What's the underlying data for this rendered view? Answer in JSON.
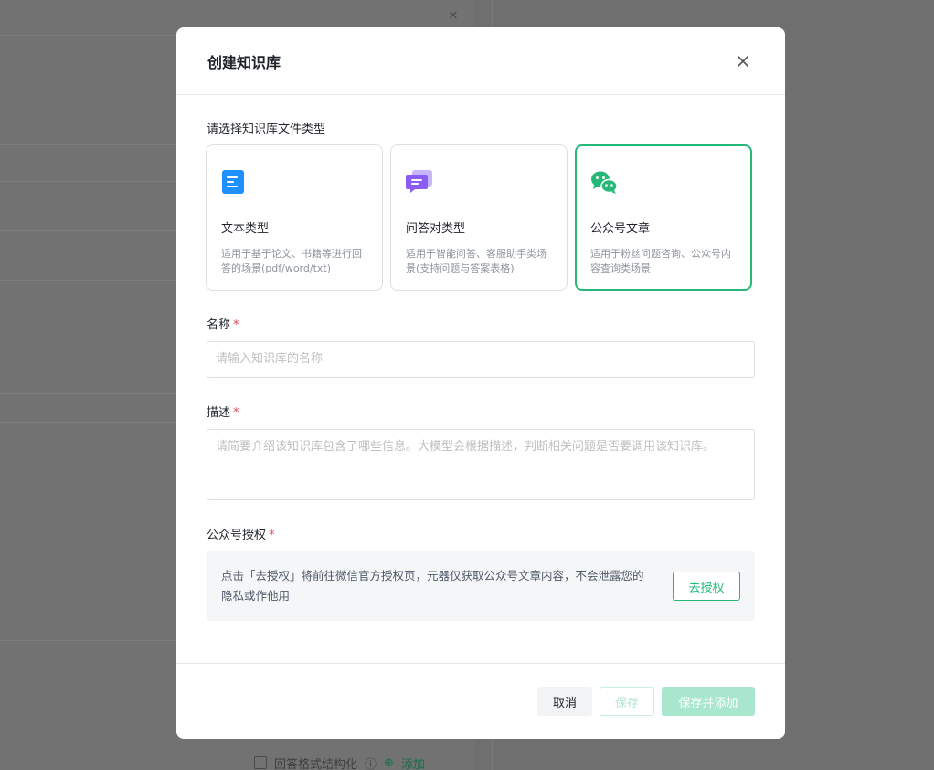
{
  "modal": {
    "title": "创建知识库",
    "close_icon": "close-icon"
  },
  "type_section": {
    "label": "请选择知识库文件类型",
    "cards": [
      {
        "name": "文本类型",
        "desc": "适用于基于论文、书籍等进行回答的场景(pdf/word/txt)",
        "icon": "document-icon",
        "color": "#1e90ff",
        "selected": false
      },
      {
        "name": "问答对类型",
        "desc": "适用于智能问答、客服助手类场景(支持问题与答案表格)",
        "icon": "chat-bubbles-icon",
        "color": "#8b5cf6",
        "selected": false
      },
      {
        "name": "公众号文章",
        "desc": "适用于粉丝问题咨询、公众号内容查询类场景",
        "icon": "wechat-icon",
        "color": "#24b978",
        "selected": true
      }
    ]
  },
  "name_field": {
    "label": "名称",
    "required_mark": "*",
    "placeholder": "请输入知识库的名称"
  },
  "desc_field": {
    "label": "描述",
    "required_mark": "*",
    "placeholder": "请简要介绍该知识库包含了哪些信息。大模型会根据描述，判断相关问题是否要调用该知识库。"
  },
  "auth_field": {
    "label": "公众号授权",
    "required_mark": "*",
    "text": "点击「去授权」将前往微信官方授权页，元器仅获取公众号文章内容，不会泄露您的隐私或作他用",
    "button": "去授权"
  },
  "footer": {
    "cancel": "取消",
    "save": "保存",
    "save_add": "保存并添加"
  },
  "background": {
    "checkbox_label": "回答格式结构化",
    "add_label": "添加"
  },
  "colors": {
    "accent": "#24b978",
    "required": "#e5484d"
  }
}
